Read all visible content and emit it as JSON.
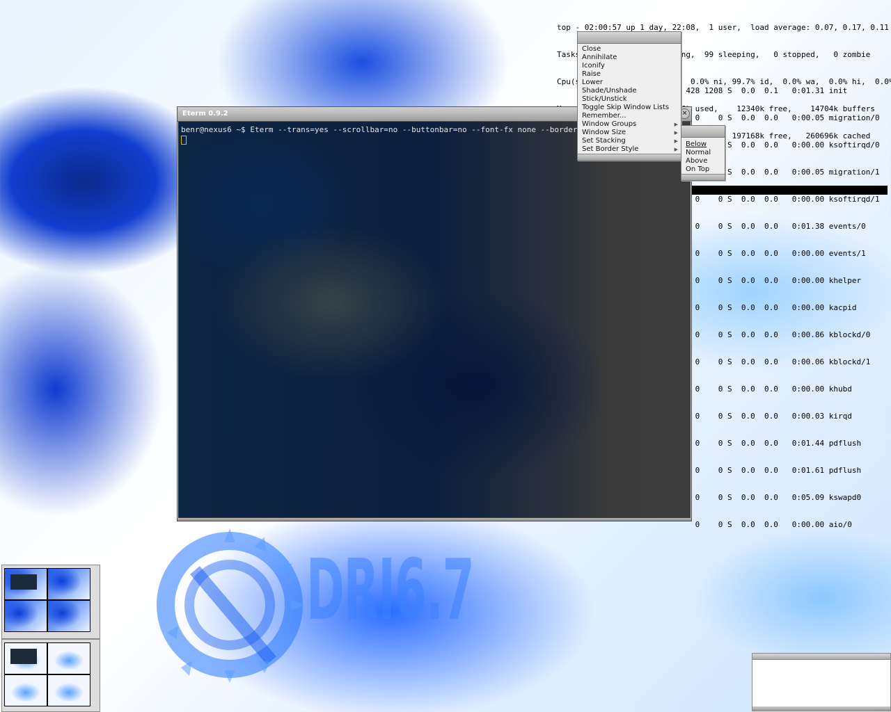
{
  "top": {
    "lines": [
      "top - 02:00:57 up 1 day, 22:08,  1 user,  load average: 0.07, 0.17, 0.11",
      "Tasks: 100 total,   1 running,  99 sleeping,   0 stopped,   0 zombie",
      "Cpu(s):  0.2% us,  0.2% sy,  0.0% ni, 99.7% id,  0.0% wa,  0.0% hi,  0.0% si",
      "Mem:                       6k used,    12340k free,    14704k buffers",
      "Swap:                      8k used,   197168k free,   260696k cached"
    ],
    "processes": [
      "                            428 1208 S  0.0  0.1   0:01.31 init",
      "                              0    0 S  0.0  0.0   0:00.05 migration/0",
      "                              0    0 S  0.0  0.0   0:00.00 ksoftirqd/0",
      "                              0    0 S  0.0  0.0   0:00.05 migration/1",
      "                              0    0 S  0.0  0.0   0:00.00 ksoftirqd/1",
      "                              0    0 S  0.0  0.0   0:01.38 events/0",
      "                              0    0 S  0.0  0.0   0:00.00 events/1",
      "                              0    0 S  0.0  0.0   0:00.00 khelper",
      "                              0    0 S  0.0  0.0   0:00.00 kacpid",
      "                              0    0 S  0.0  0.0   0:00.86 kblockd/0",
      "                              0    0 S  0.0  0.0   0:00.06 kblockd/1",
      "                              0    0 S  0.0  0.0   0:00.00 khubd",
      "                              0    0 S  0.0  0.0   0:00.03 kirqd",
      "                              0    0 S  0.0  0.0   0:01.44 pdflush",
      "                              0    0 S  0.0  0.0   0:01.61 pdflush",
      "                              0    0 S  0.0  0.0   0:05.09 kswapd0",
      "                              0    0 S  0.0  0.0   0:00.00 aio/0"
    ]
  },
  "eterm": {
    "title": "Eterm 0.9.2",
    "command_line": "benr@nexus6 ~$ Eterm --trans=yes --scrollbar=no --buttonbar=no --font-fx none --borderless -f b"
  },
  "window_menu": {
    "items": [
      {
        "label": "Close",
        "submenu": false
      },
      {
        "label": "Annihilate",
        "submenu": false
      },
      {
        "label": "Iconify",
        "submenu": false
      },
      {
        "label": "Raise",
        "submenu": false
      },
      {
        "label": "Lower",
        "submenu": false
      },
      {
        "label": "Shade/Unshade",
        "submenu": false
      },
      {
        "label": "Stick/Unstick",
        "submenu": false
      },
      {
        "label": "Toggle Skip Window Lists",
        "submenu": false
      },
      {
        "label": "Remember...",
        "submenu": false
      },
      {
        "label": "Window Groups",
        "submenu": true
      },
      {
        "label": "Window Size",
        "submenu": true
      },
      {
        "label": "Set Stacking",
        "submenu": true
      },
      {
        "label": "Set Border Style",
        "submenu": true
      }
    ]
  },
  "stacking_menu": {
    "items": [
      "Below",
      "Normal",
      "Above",
      "On Top"
    ],
    "selected": "Below"
  },
  "wallpaper": {
    "logo_text": "DRI6.7"
  },
  "colors": {
    "cursor": "#d8c000",
    "terminal_text": "#e6e6e6"
  }
}
